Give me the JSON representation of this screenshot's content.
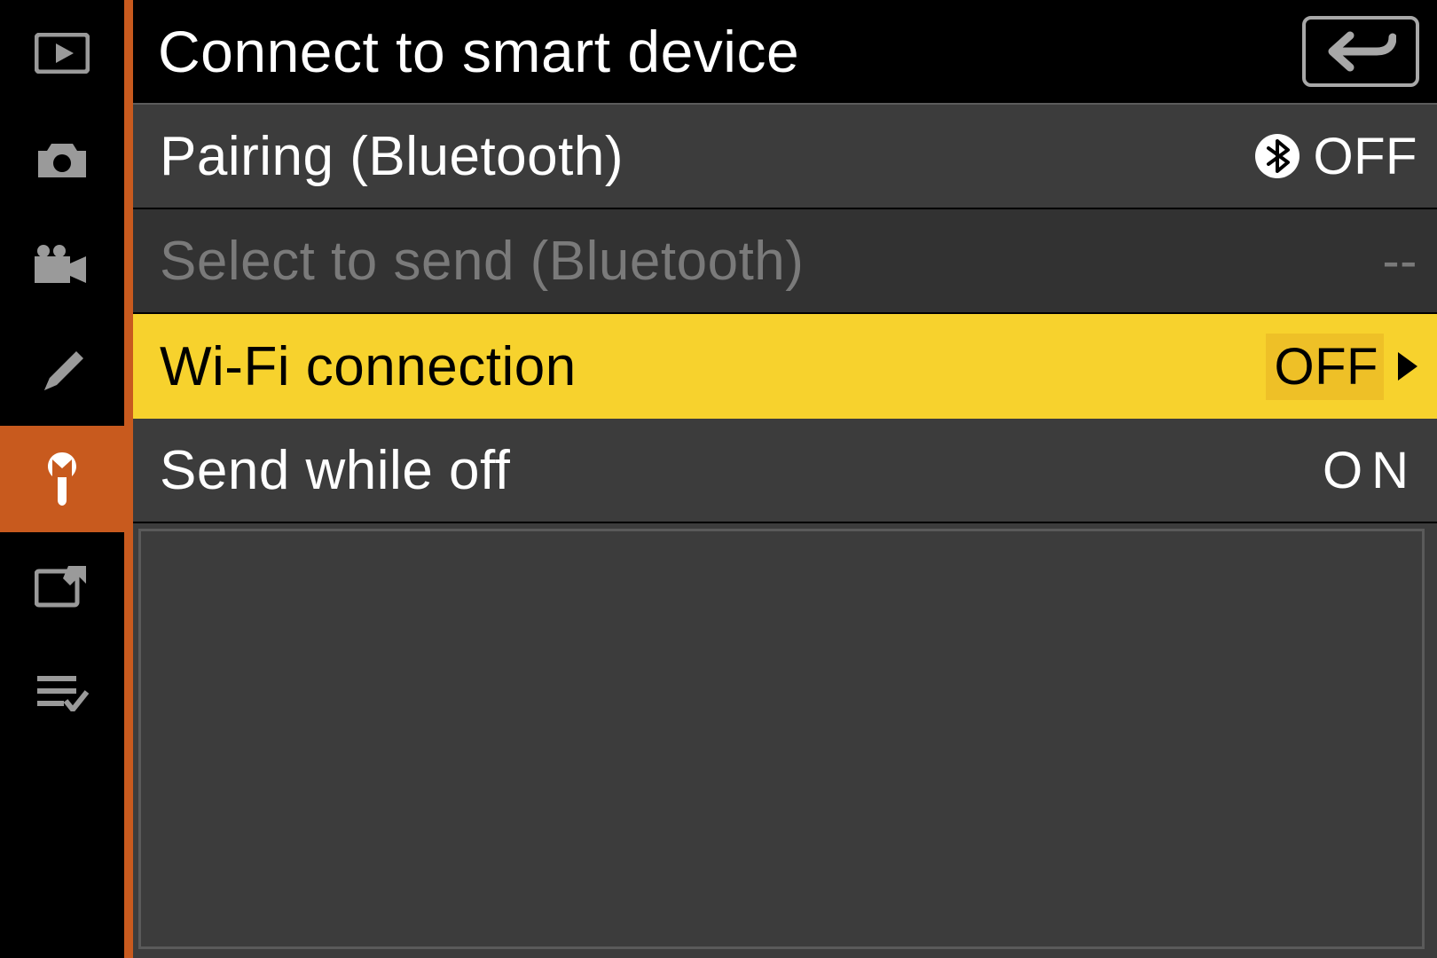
{
  "header": {
    "title": "Connect to smart device"
  },
  "sidebar": {
    "items": [
      {
        "name": "playback-tab"
      },
      {
        "name": "photo-shooting-tab"
      },
      {
        "name": "movie-shooting-tab"
      },
      {
        "name": "custom-settings-tab"
      },
      {
        "name": "setup-tab",
        "active": true
      },
      {
        "name": "retouch-tab"
      },
      {
        "name": "my-menu-tab"
      }
    ]
  },
  "menu": {
    "items": [
      {
        "label": "Pairing (Bluetooth)",
        "value": "OFF",
        "has_bluetooth_icon": true,
        "state": "normal"
      },
      {
        "label": "Select to send (Bluetooth)",
        "value": "--",
        "state": "disabled"
      },
      {
        "label": "Wi-Fi connection",
        "value": "OFF",
        "state": "selected",
        "has_arrow": true
      },
      {
        "label": "Send while off",
        "value": "ON",
        "state": "normal"
      }
    ]
  }
}
